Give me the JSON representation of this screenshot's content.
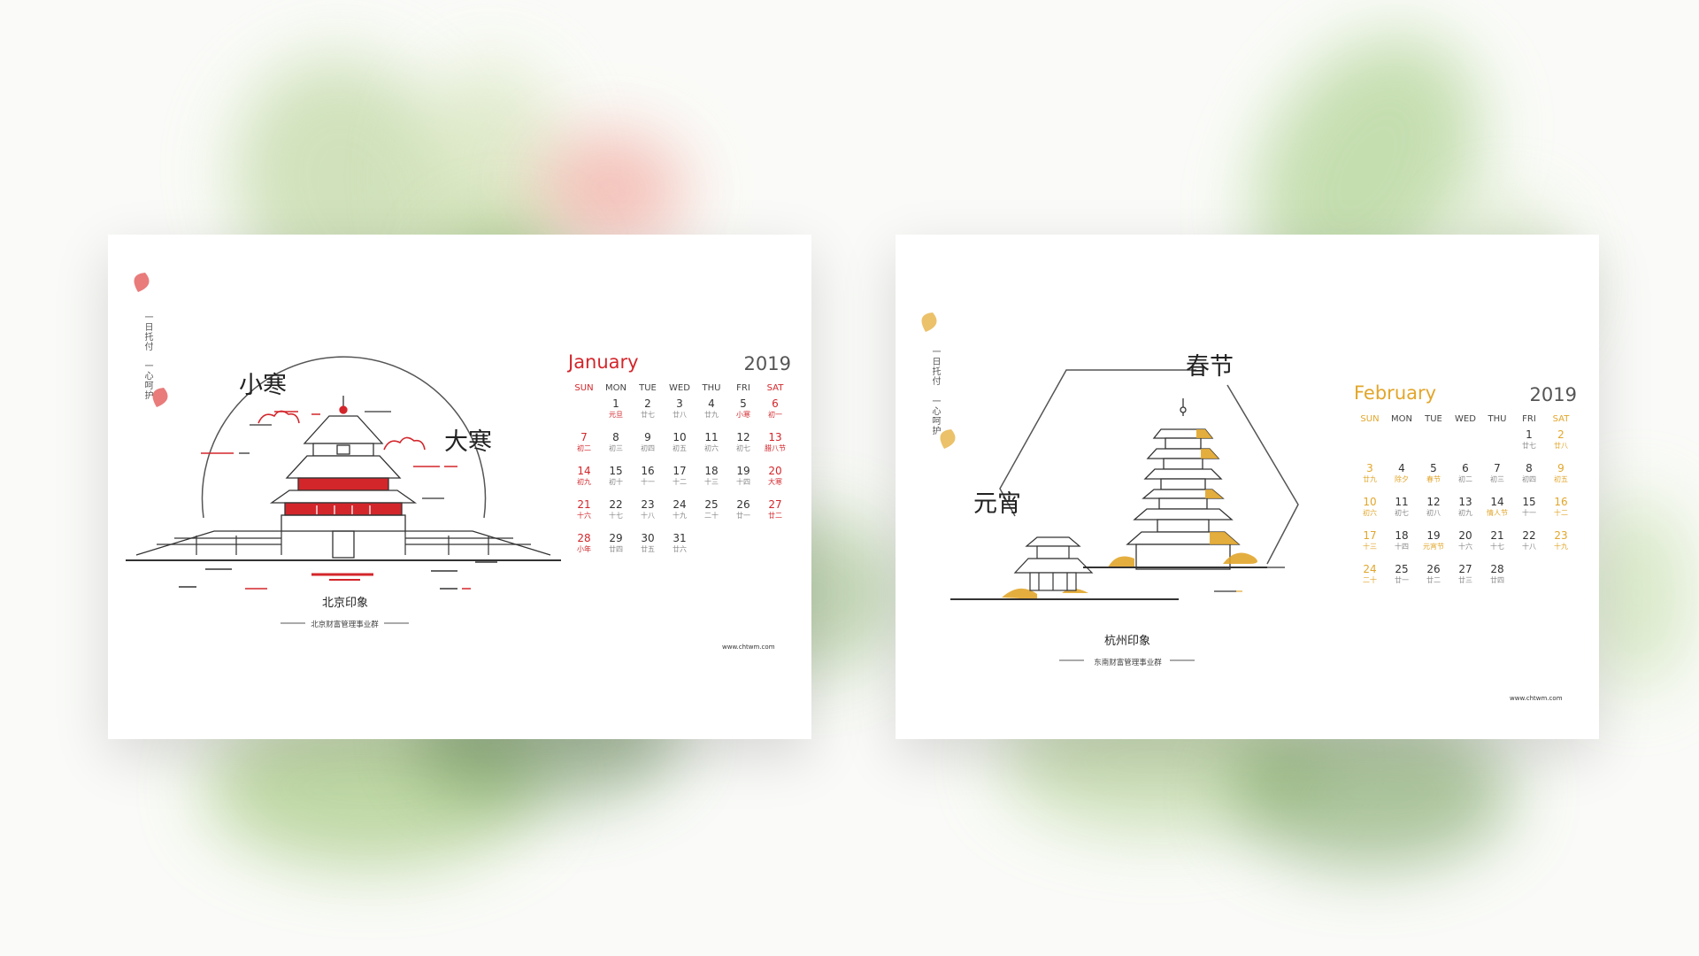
{
  "colors": {
    "jan_accent": "#d3262b",
    "feb_accent": "#e2a62b",
    "text": "#333333",
    "lunar": "#888888"
  },
  "jan": {
    "month": "January",
    "year": "2019",
    "dow": [
      "SUN",
      "MON",
      "TUE",
      "WED",
      "THU",
      "FRI",
      "SAT"
    ],
    "weeks": [
      [
        null,
        {
          "d": "1",
          "l": "元旦",
          "h": true
        },
        {
          "d": "2",
          "l": "廿七"
        },
        {
          "d": "3",
          "l": "廿八"
        },
        {
          "d": "4",
          "l": "廿九"
        },
        {
          "d": "5",
          "l": "小寒",
          "h": true
        },
        {
          "d": "6",
          "l": "初一"
        }
      ],
      [
        {
          "d": "7",
          "l": "初二"
        },
        {
          "d": "8",
          "l": "初三"
        },
        {
          "d": "9",
          "l": "初四"
        },
        {
          "d": "10",
          "l": "初五"
        },
        {
          "d": "11",
          "l": "初六"
        },
        {
          "d": "12",
          "l": "初七"
        },
        {
          "d": "13",
          "l": "腊八节",
          "h": true
        }
      ],
      [
        {
          "d": "14",
          "l": "初九"
        },
        {
          "d": "15",
          "l": "初十"
        },
        {
          "d": "16",
          "l": "十一"
        },
        {
          "d": "17",
          "l": "十二"
        },
        {
          "d": "18",
          "l": "十三"
        },
        {
          "d": "19",
          "l": "十四"
        },
        {
          "d": "20",
          "l": "大寒",
          "h": true
        }
      ],
      [
        {
          "d": "21",
          "l": "十六"
        },
        {
          "d": "22",
          "l": "十七"
        },
        {
          "d": "23",
          "l": "十八"
        },
        {
          "d": "24",
          "l": "十九"
        },
        {
          "d": "25",
          "l": "二十"
        },
        {
          "d": "26",
          "l": "廿一"
        },
        {
          "d": "27",
          "l": "廿二"
        }
      ],
      [
        {
          "d": "28",
          "l": "小年",
          "h": true
        },
        {
          "d": "29",
          "l": "廿四"
        },
        {
          "d": "30",
          "l": "廿五"
        },
        {
          "d": "31",
          "l": "廿六"
        },
        null,
        null,
        null
      ]
    ],
    "title": "北京印象",
    "subtitle": "北京财富管理事业群",
    "site": "www.chtwm.com",
    "vertical_1": "一日托付",
    "vertical_2": "一心呵护",
    "term_left": "小寒",
    "term_right": "大寒"
  },
  "feb": {
    "month": "February",
    "year": "2019",
    "dow": [
      "SUN",
      "MON",
      "TUE",
      "WED",
      "THU",
      "FRI",
      "SAT"
    ],
    "weeks": [
      [
        null,
        null,
        null,
        null,
        null,
        {
          "d": "1",
          "l": "廿七"
        },
        {
          "d": "2",
          "l": "廿八"
        }
      ],
      [
        {
          "d": "3",
          "l": "廿九"
        },
        {
          "d": "4",
          "l": "除夕",
          "h": true
        },
        {
          "d": "5",
          "l": "春节",
          "h": true
        },
        {
          "d": "6",
          "l": "初二"
        },
        {
          "d": "7",
          "l": "初三"
        },
        {
          "d": "8",
          "l": "初四"
        },
        {
          "d": "9",
          "l": "初五"
        }
      ],
      [
        {
          "d": "10",
          "l": "初六"
        },
        {
          "d": "11",
          "l": "初七"
        },
        {
          "d": "12",
          "l": "初八"
        },
        {
          "d": "13",
          "l": "初九"
        },
        {
          "d": "14",
          "l": "情人节",
          "h": true
        },
        {
          "d": "15",
          "l": "十一"
        },
        {
          "d": "16",
          "l": "十二"
        }
      ],
      [
        {
          "d": "17",
          "l": "十三"
        },
        {
          "d": "18",
          "l": "十四"
        },
        {
          "d": "19",
          "l": "元宵节",
          "h": true
        },
        {
          "d": "20",
          "l": "十六"
        },
        {
          "d": "21",
          "l": "十七"
        },
        {
          "d": "22",
          "l": "十八"
        },
        {
          "d": "23",
          "l": "十九"
        }
      ],
      [
        {
          "d": "24",
          "l": "二十"
        },
        {
          "d": "25",
          "l": "廿一"
        },
        {
          "d": "26",
          "l": "廿二"
        },
        {
          "d": "27",
          "l": "廿三"
        },
        {
          "d": "28",
          "l": "廿四"
        },
        null,
        null
      ]
    ],
    "title": "杭州印象",
    "subtitle": "东南财富管理事业群",
    "site": "www.chtwm.com",
    "vertical_1": "一日托付",
    "vertical_2": "一心呵护",
    "term_top": "春节",
    "term_left": "元宵"
  }
}
